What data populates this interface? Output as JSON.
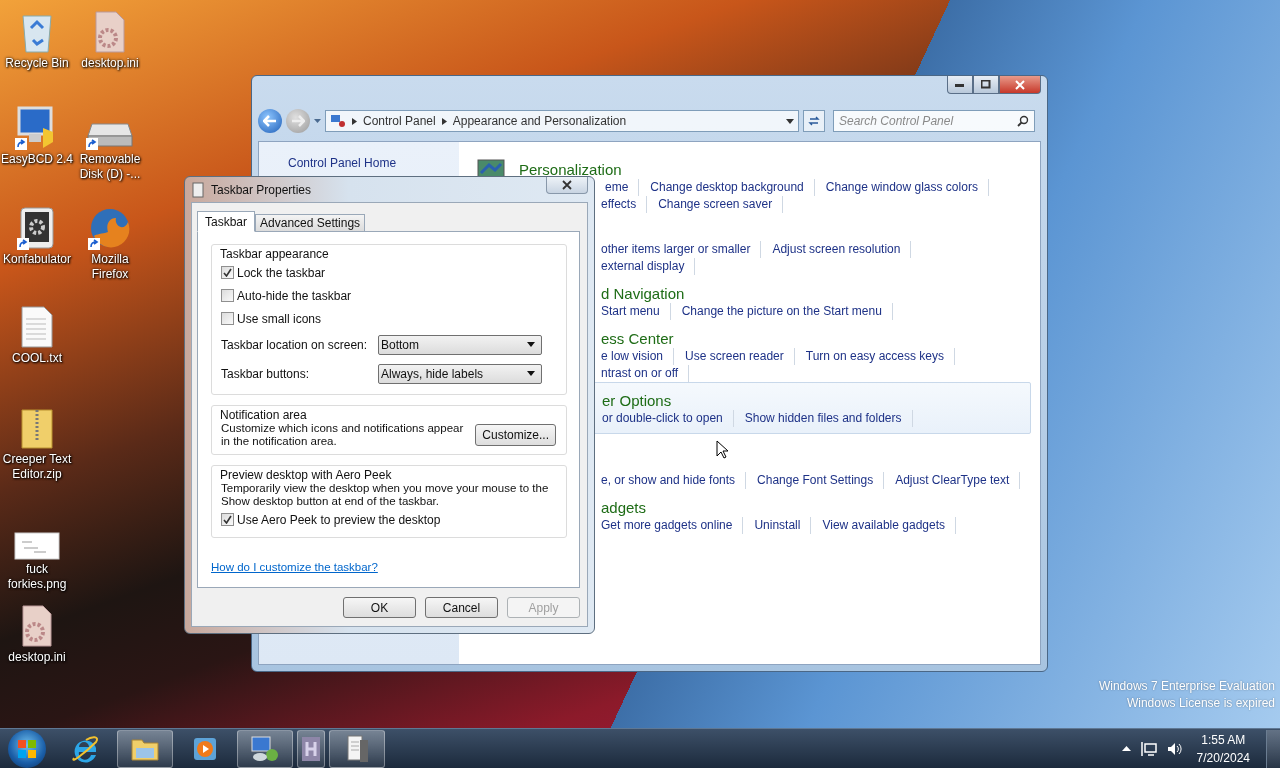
{
  "desktop_icons": [
    {
      "label": "Recycle Bin",
      "kind": "recycle-bin",
      "shortcut": false
    },
    {
      "label": "desktop.ini",
      "kind": "settings-file",
      "shortcut": false
    },
    {
      "label": "EasyBCD 2.4",
      "kind": "monitor",
      "shortcut": true
    },
    {
      "label": "Removable Disk (D) -...",
      "kind": "drive",
      "shortcut": true
    },
    {
      "label": "Konfabulator",
      "kind": "gear-app",
      "shortcut": true
    },
    {
      "label": "Mozilla Firefox",
      "kind": "globe",
      "shortcut": true
    },
    {
      "label": "COOL.txt",
      "kind": "text-file",
      "shortcut": false
    },
    {
      "label": "Creeper Text Editor.zip",
      "kind": "zip-folder",
      "shortcut": false
    },
    {
      "label": "fuck forkies.png",
      "kind": "image",
      "shortcut": false
    },
    {
      "label": "desktop.ini",
      "kind": "settings-file",
      "shortcut": false
    }
  ],
  "control_panel": {
    "address": [
      "Control Panel",
      "Appearance and Personalization"
    ],
    "search": {
      "placeholder": "Search Control Panel"
    },
    "sidebar": {
      "items": [
        {
          "label": "Control Panel Home"
        }
      ]
    },
    "categories": [
      {
        "title": "Personalization",
        "highlighted": false,
        "rows": [
          [
            "eme",
            "Change desktop background",
            "Change window glass colors"
          ],
          [
            "effects",
            "Change screen saver"
          ]
        ]
      },
      {
        "highlighted": false,
        "rows": [
          [
            "other items larger or smaller",
            "Adjust screen resolution"
          ],
          [
            "external display"
          ]
        ]
      },
      {
        "title": "d Navigation",
        "highlighted": false,
        "rows": [
          [
            "Start menu",
            "Change the picture on the Start menu"
          ]
        ]
      },
      {
        "title": "ess Center",
        "highlighted": false,
        "rows": [
          [
            "e low vision",
            "Use screen reader",
            "Turn on easy access keys"
          ],
          [
            "ntrast on or off"
          ]
        ]
      },
      {
        "title": "er Options",
        "highlighted": true,
        "rows": [
          [
            "or double-click to open",
            "Show hidden files and folders"
          ]
        ]
      },
      {
        "highlighted": false,
        "rows": [
          [
            "e, or show and hide fonts",
            "Change Font Settings",
            "Adjust ClearType text"
          ]
        ]
      },
      {
        "title": "adgets",
        "highlighted": false,
        "rows": [
          [
            "Get more gadgets online",
            "Uninstall",
            "View available gadgets"
          ]
        ]
      }
    ]
  },
  "dialog": {
    "title": "Taskbar Properties",
    "tabs": [
      {
        "label": "Taskbar",
        "selected": true
      },
      {
        "label": "Advanced Settings",
        "selected": false
      }
    ],
    "groups": [
      {
        "title": "Taskbar appearance",
        "items": [
          {
            "kind": "checkbox",
            "label": "Lock the taskbar",
            "checked": true
          },
          {
            "kind": "checkbox",
            "label": "Auto-hide the taskbar",
            "checked": false
          },
          {
            "kind": "checkbox",
            "label": "Use small icons",
            "checked": false
          },
          {
            "kind": "dropdown",
            "label": "Taskbar location on screen:",
            "value": "Bottom"
          },
          {
            "kind": "dropdown",
            "label": "Taskbar buttons:",
            "value": "Always, hide labels"
          }
        ]
      },
      {
        "title": "Notification area",
        "items": [
          {
            "kind": "text_button",
            "text": "Customize which icons and notifications appear in the notification area.",
            "button": "Customize..."
          }
        ]
      },
      {
        "title": "Preview desktop with Aero Peek",
        "items": [
          {
            "kind": "text",
            "text": "Temporarily view the desktop when you move your mouse to the Show desktop button at end of the taskbar."
          },
          {
            "kind": "checkbox",
            "label": "Use Aero Peek to preview the desktop",
            "checked": true
          }
        ]
      }
    ],
    "help_link": "How do I customize the taskbar?",
    "buttons": [
      {
        "label": "OK",
        "disabled": false
      },
      {
        "label": "Cancel",
        "disabled": false
      },
      {
        "label": "Apply",
        "disabled": true
      }
    ]
  },
  "system_text": [
    "Windows 7 Enterprise Evaluation",
    "Windows License is expired"
  ],
  "taskbar": {
    "items": [
      {
        "kind": "browser",
        "running": false
      },
      {
        "kind": "folder",
        "running": true
      },
      {
        "kind": "media-player",
        "running": false
      },
      {
        "kind": "control-panel",
        "running": true
      },
      {
        "kind": "letter-app",
        "running": true
      },
      {
        "kind": "document-app",
        "running": true
      }
    ],
    "clock": {
      "time": "1:55 AM",
      "date": "7/20/2024"
    }
  }
}
